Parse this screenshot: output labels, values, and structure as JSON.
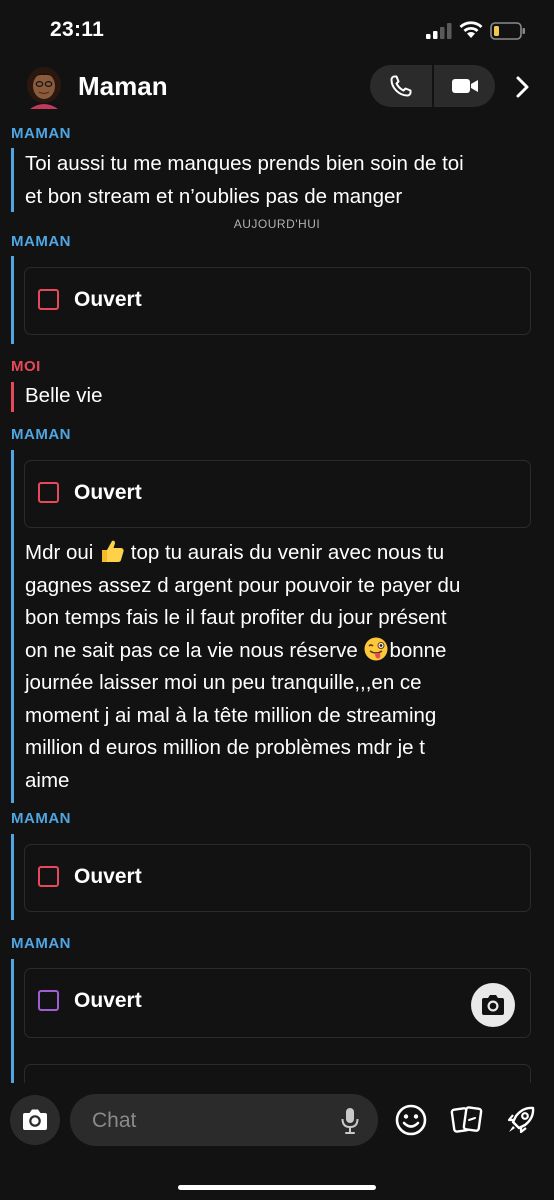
{
  "status": {
    "time": "23:11"
  },
  "header": {
    "contact_name": "Maman"
  },
  "messages": {
    "m1_sender": "MAMAN",
    "m1_text_line1": "Toi aussi tu me manques prends bien soin de toi",
    "m1_text_line2": "et bon stream et n’oublies pas de manger",
    "divider": "AUJOURD'HUI",
    "m2_sender": "MAMAN",
    "m2_snap": "Ouvert",
    "m3_sender": "MOI",
    "m3_text": "Belle vie",
    "m4_sender": "MAMAN",
    "m4_snap": "Ouvert",
    "m4_line1a": "Mdr oui",
    "m4_line1b": " top tu aurais du venir avec nous tu",
    "m4_line2": "gagnes assez d argent pour pouvoir te payer du",
    "m4_line3": "bon temps fais le il faut profiter du jour présent",
    "m4_line4a": "on ne sait pas ce la vie nous réserve",
    "m4_line4b": "bonne",
    "m4_line5": "journée laisser moi un peu tranquille,,,en ce",
    "m4_line6": "moment j ai mal à la tête million de streaming",
    "m4_line7": "million d euros million de problèmes mdr je t",
    "m4_line8": "aime",
    "m5_sender": "MAMAN",
    "m5_snap": "Ouvert",
    "m6_sender": "MAMAN",
    "m6_snap": "Ouvert"
  },
  "composer": {
    "placeholder": "Chat"
  },
  "icons": {
    "call": "phone-icon",
    "video": "video-icon",
    "more": "chevron-right-icon",
    "camera": "camera-icon",
    "mic": "microphone-icon",
    "bitmoji": "smiley-icon",
    "stickers": "cards-icon",
    "games": "rocket-icon"
  },
  "colors": {
    "background": "#121212",
    "mom_accent": "#4fa6e3",
    "me_accent": "#e8485b",
    "snap_red": "#e8485b",
    "snap_purple": "#a05fd0",
    "surface": "#2b2b2b"
  }
}
